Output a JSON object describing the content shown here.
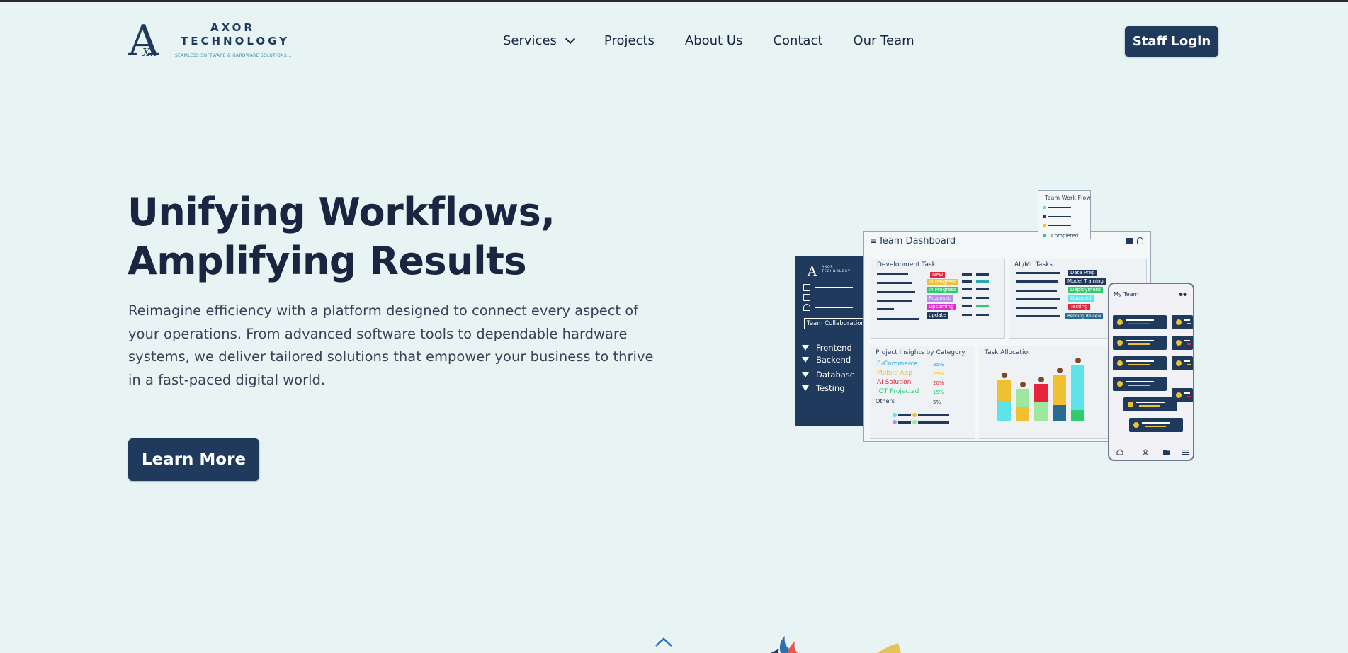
{
  "header": {
    "logo": {
      "mark": "A",
      "mark_sub": "Xn",
      "name_line1": "AXOR",
      "name_line2": "TECHNOLOGY",
      "tagline": "SEAMLESS SOFTWARE & HARDWARE SOLUTIONS..."
    },
    "nav": [
      {
        "label": "Services",
        "has_dropdown": true
      },
      {
        "label": "Projects"
      },
      {
        "label": "About Us"
      },
      {
        "label": "Contact"
      },
      {
        "label": "Our Team"
      }
    ],
    "staff_login": "Staff Login"
  },
  "hero": {
    "title_line1": "Unifying Workflows,",
    "title_line2": "Amplifying Results",
    "description": "Reimagine efficiency with a platform designed to connect every aspect of your operations. From advanced software tools to dependable hardware systems, we deliver tailored solutions that empower your business to thrive in a fast-paced digital world.",
    "cta": "Learn More"
  },
  "illustration": {
    "sidebar": {
      "logo_mark": "A",
      "logo_text": "AXOR TECHNOLOGY",
      "collab_button": "Team Collaboration",
      "items": [
        "Frontend",
        "Backend",
        "Database",
        "Testing"
      ]
    },
    "dashboard": {
      "title": "Team Dashboard",
      "dev_tasks": {
        "title": "Development Task",
        "badges": [
          {
            "label": "New",
            "color": "#e8243c"
          },
          {
            "label": "In Progress",
            "color": "#f0c030"
          },
          {
            "label": "In Progress",
            "color": "#2ecc71"
          },
          {
            "label": "Proposed",
            "color": "#b98cf0"
          },
          {
            "label": "Upcoming",
            "color": "#e030d0"
          },
          {
            "label": "update",
            "color": "#1f3a5c"
          }
        ]
      },
      "ml_tasks": {
        "title": "AL/ML Tasks",
        "badges": [
          {
            "label": "Data Prep",
            "color": "#1f3a5c"
          },
          {
            "label": "Model Training",
            "color": "#1f3a5c"
          },
          {
            "label": "Deployment",
            "color": "#2ecc71"
          },
          {
            "label": "Updated",
            "color": "#5ee3ea"
          },
          {
            "label": "Testing",
            "color": "#e8243c"
          },
          {
            "label": "Pending Review",
            "color": "#2a6b8f"
          }
        ]
      },
      "insights": {
        "title": "Project insights by Category",
        "categories": [
          {
            "label": "E-Commerce",
            "pct": "35%",
            "color": "#2aa8e0"
          },
          {
            "label": "Mobile App",
            "pct": "25%",
            "color": "#f0c030"
          },
          {
            "label": "AI Solution",
            "pct": "20%",
            "color": "#e8243c"
          },
          {
            "label": "IOT Projectsd",
            "pct": "15%",
            "color": "#2ecc71"
          },
          {
            "label": "Others",
            "pct": "5%",
            "color": "#1b2440"
          }
        ]
      },
      "task_allocation": {
        "title": "Task Allocation"
      }
    },
    "team_workflow": {
      "title": "Team Work Flow",
      "completed": "Completed"
    },
    "my_team": {
      "title": "My Team"
    }
  },
  "colors": {
    "background": "#e8f3f3",
    "primary": "#1f3a5c",
    "text": "#1b2440"
  }
}
